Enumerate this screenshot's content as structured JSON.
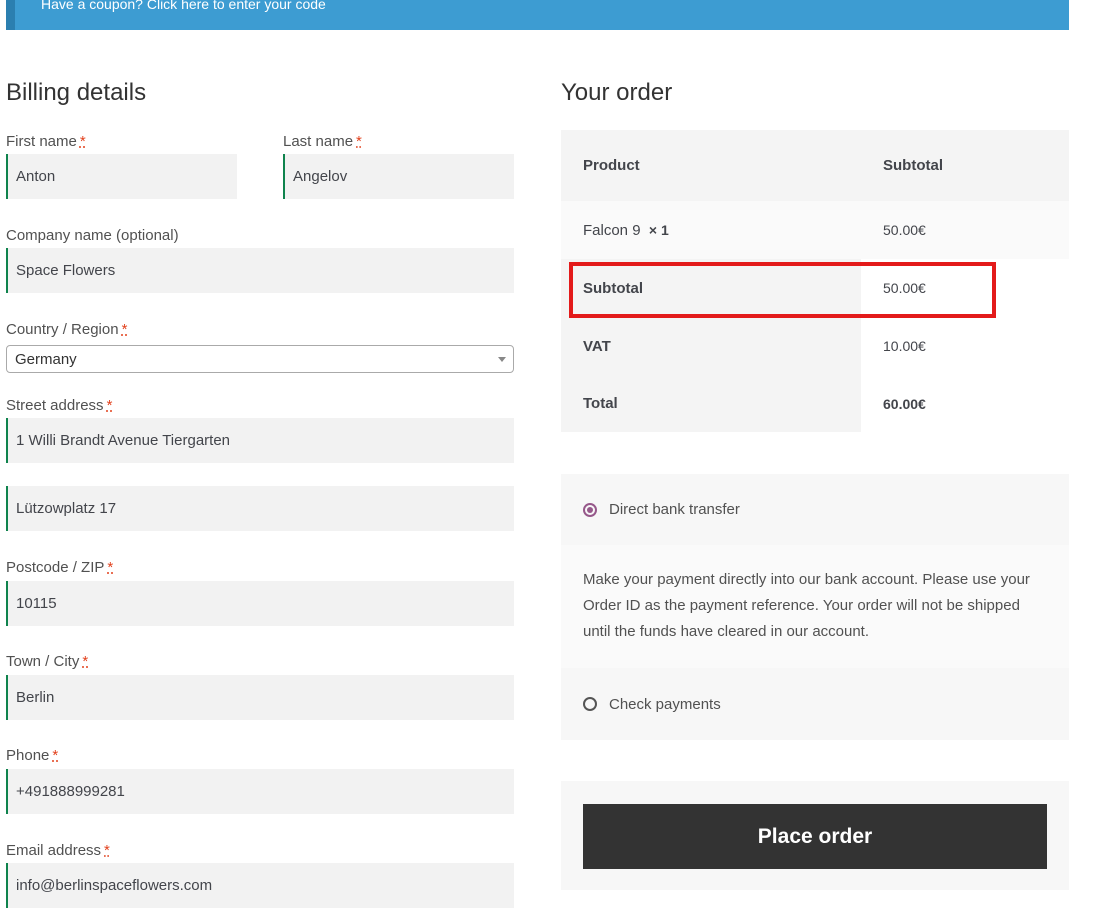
{
  "coupon": {
    "text": "Have a coupon? Click here to enter your code"
  },
  "billing": {
    "title": "Billing details",
    "required_mark": "*",
    "first_name": {
      "label": "First name",
      "value": "Anton"
    },
    "last_name": {
      "label": "Last name",
      "value": "Angelov"
    },
    "company": {
      "label": "Company name (optional)",
      "value": "Space Flowers"
    },
    "country": {
      "label": "Country / Region",
      "value": "Germany"
    },
    "street": {
      "label": "Street address",
      "value": "1 Willi Brandt Avenue Tiergarten",
      "value2": "Lützowplatz 17"
    },
    "postcode": {
      "label": "Postcode / ZIP",
      "value": "10115"
    },
    "city": {
      "label": "Town / City",
      "value": "Berlin"
    },
    "phone": {
      "label": "Phone",
      "value": "+491888999281"
    },
    "email": {
      "label": "Email address",
      "value": "info@berlinspaceflowers.com"
    }
  },
  "order": {
    "title": "Your order",
    "header": {
      "product": "Product",
      "subtotal": "Subtotal"
    },
    "item": {
      "name": "Falcon 9",
      "qty": "× 1",
      "price": "50.00€"
    },
    "subtotal": {
      "label": "Subtotal",
      "value": "50.00€"
    },
    "vat": {
      "label": "VAT",
      "value": "10.00€"
    },
    "total": {
      "label": "Total",
      "value": "60.00€"
    }
  },
  "payment": {
    "option1": "Direct bank transfer",
    "description": "Make your payment directly into our bank account. Please use your Order ID as the payment reference. Your order will not be shipped until the funds have cleared in our account.",
    "option2": "Check payments",
    "place_order": "Place order"
  },
  "colors": {
    "accent_blue": "#3d9cd2",
    "highlight_red": "#e31a1a",
    "input_border_green": "#0f834d",
    "radio_purple": "#96588a"
  }
}
